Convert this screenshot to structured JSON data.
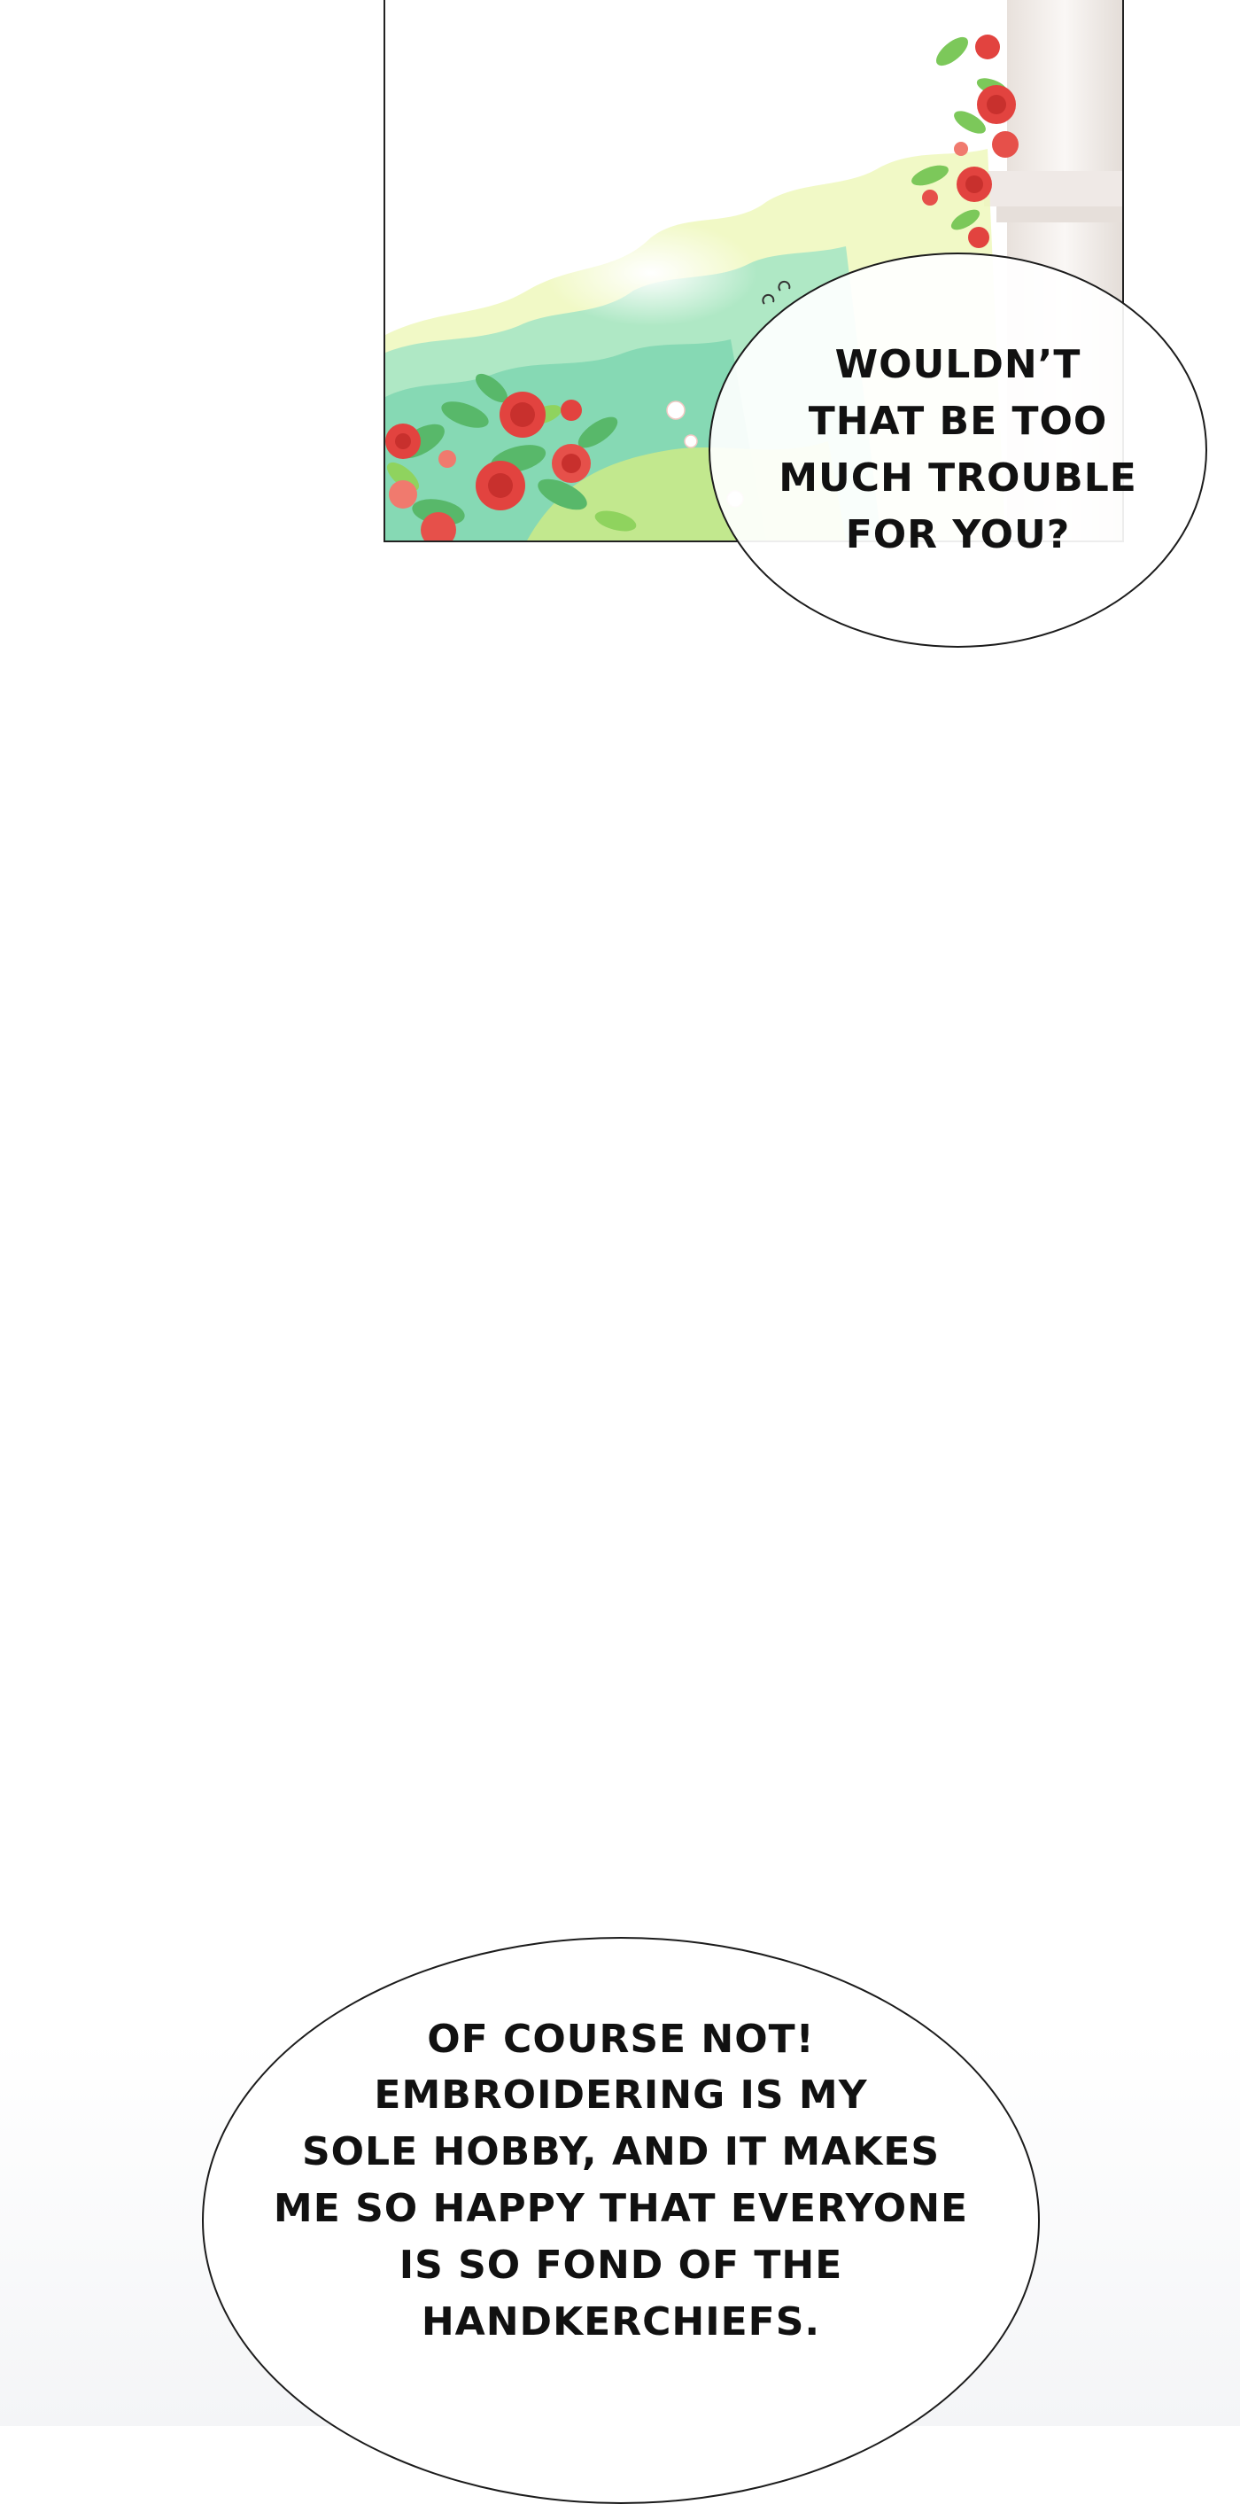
{
  "panel": {
    "illustration": "rose-garden-illustration"
  },
  "bubbles": {
    "first": {
      "text": "WOULDN’T\nTHAT BE TOO\nMUCH TROUBLE\nFOR YOU?"
    },
    "second": {
      "text": "OF COURSE NOT!\nEMBROIDERING IS MY\nSOLE HOBBY, AND IT MAKES\nME SO HAPPY THAT EVERYONE\nIS SO FOND OF THE\nHANDKERCHIEFS."
    }
  },
  "colors": {
    "rose": "#e2433f",
    "foliage": "#6cc57a",
    "mint": "#7fd8c0",
    "yellow_green": "#d8ea7a",
    "pillar": "#f2eeec"
  }
}
